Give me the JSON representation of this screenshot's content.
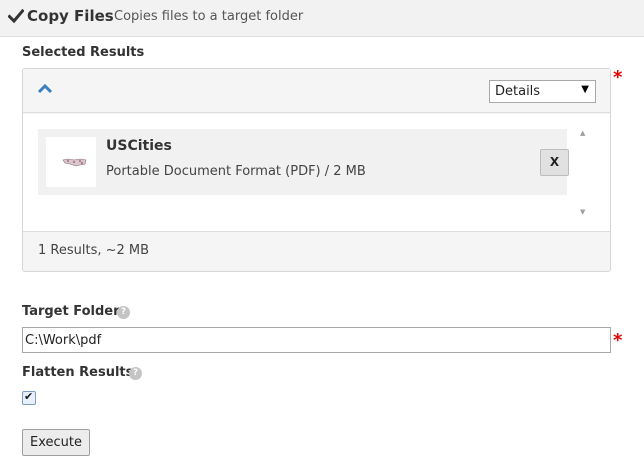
{
  "header": {
    "title": "Copy Files",
    "subtitle": "Copies files to a target folder",
    "icon": "checkmark-icon"
  },
  "selected_results": {
    "label": "Selected Results",
    "view_select": {
      "value": "Details"
    },
    "items": [
      {
        "name": "USCities",
        "description": "Portable Document Format (PDF) / 2 MB",
        "remove_label": "X",
        "thumbnail_icon": "us-map-thumbnail"
      }
    ],
    "summary": "1 Results, ~2 MB",
    "required_mark": "*"
  },
  "target_folder": {
    "label": "Target Folder",
    "help_glyph": "?",
    "value": "C:\\Work\\pdf",
    "required_mark": "*"
  },
  "flatten_results": {
    "label": "Flatten Results",
    "help_glyph": "?",
    "checked": true
  },
  "actions": {
    "execute_label": "Execute"
  },
  "colors": {
    "accent_blue": "#3a7fc4",
    "required_red": "#e40000",
    "header_bg": "#f2f2f2"
  }
}
